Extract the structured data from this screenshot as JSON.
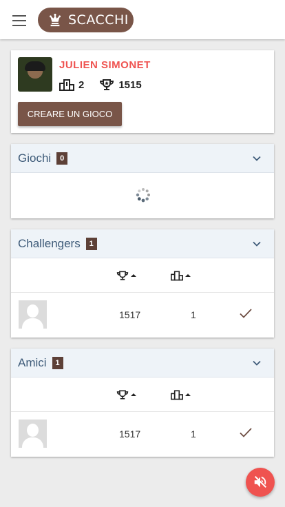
{
  "header": {
    "brand_label": "SCACCHI",
    "menu_icon": "hamburger-icon",
    "brand_icon": "chess-king-icon"
  },
  "profile": {
    "name": "JULIEN SIMONET",
    "rank": "2",
    "rating": "1515",
    "create_game_label": "CREARE UN GIOCO"
  },
  "games": {
    "title": "Giochi",
    "count": "0",
    "loading": true
  },
  "challengers": {
    "title": "Challengers",
    "count": "1",
    "columns": [
      "trophy-icon",
      "podium-icon"
    ],
    "rows": [
      {
        "rating": "1517",
        "rank": "1"
      }
    ]
  },
  "friends": {
    "title": "Amici",
    "count": "1",
    "columns": [
      "trophy-icon",
      "podium-icon"
    ],
    "rows": [
      {
        "rating": "1517",
        "rank": "1"
      }
    ]
  },
  "sound_button_icon": "volume-off-icon",
  "colors": {
    "brand": "#795548",
    "badge": "#5d4037",
    "accent_red": "#ef5350",
    "panel_header": "#eef3f8",
    "panel_title": "#3d5a78"
  }
}
